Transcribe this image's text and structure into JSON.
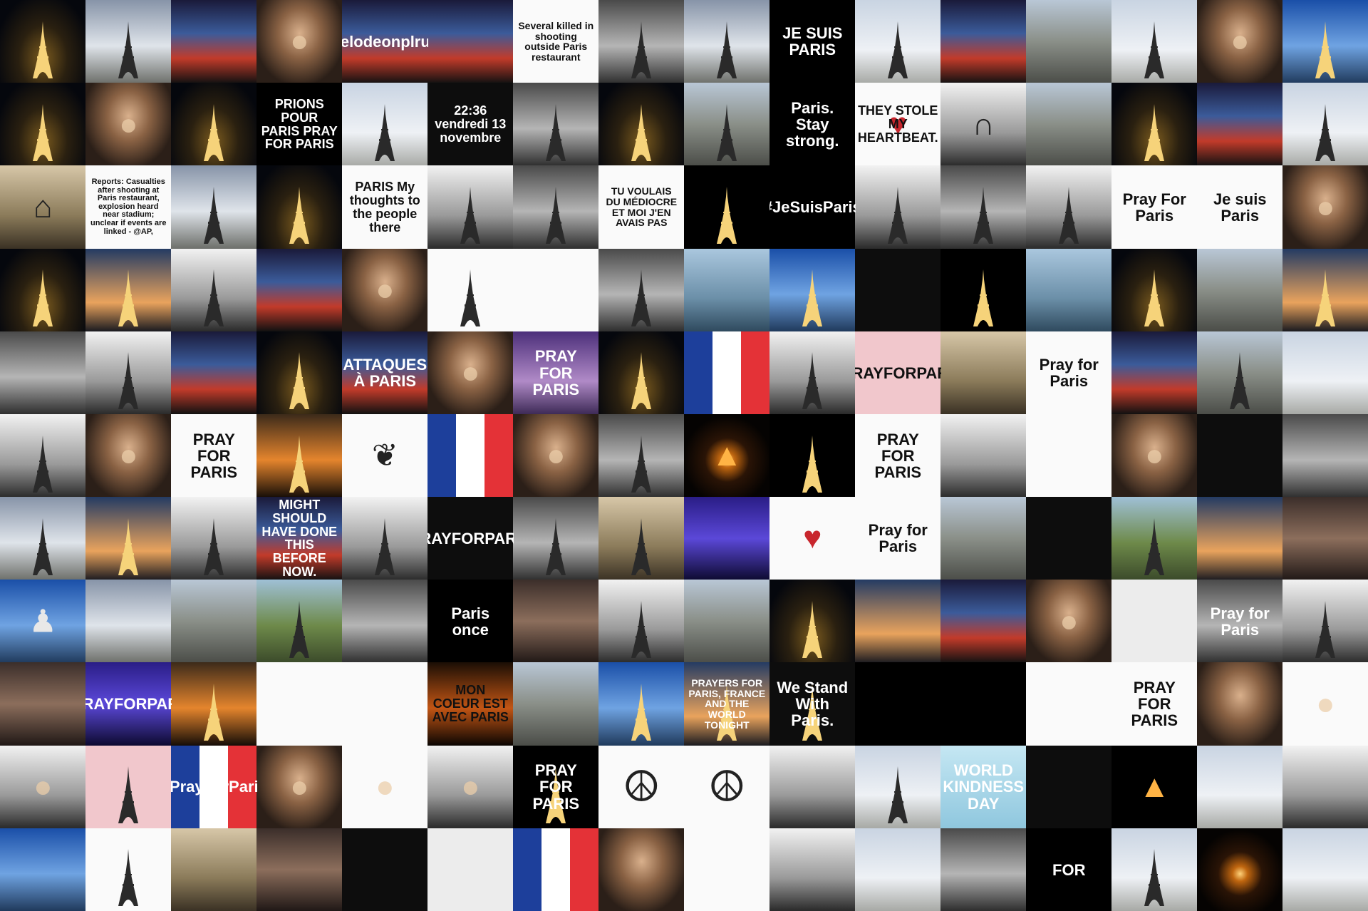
{
  "grid": {
    "columns": 16,
    "rows": 11
  },
  "accent_bar_color": "#2c3f8f",
  "tiles": [
    {
      "style": "bg-night",
      "icon": "eiffel-tower-icon"
    },
    {
      "style": "bg-cloud",
      "icon": "eiffel-tower-icon"
    },
    {
      "style": "bg-news",
      "icon": ""
    },
    {
      "style": "bg-portrait",
      "icon": "person-icon"
    },
    {
      "style": "bg-news",
      "icon": "",
      "text": "nickelodeonplrurner"
    },
    {
      "style": "bg-news",
      "icon": ""
    },
    {
      "style": "bg-white",
      "icon": "",
      "text": "Several killed in shooting outside Paris restaurant",
      "text_style": "t-dark"
    },
    {
      "style": "bg-gray",
      "icon": "eiffel-tower-icon"
    },
    {
      "style": "bg-cloud",
      "icon": "eiffel-tower-icon"
    },
    {
      "style": "bg-black",
      "icon": "",
      "text": "JE SUIS PARIS",
      "text_style": "t-light"
    },
    {
      "style": "bg-sky",
      "icon": "eiffel-tower-icon"
    },
    {
      "style": "bg-news",
      "icon": ""
    },
    {
      "style": "bg-city",
      "icon": ""
    },
    {
      "style": "bg-sky",
      "icon": "eiffel-tower-icon"
    },
    {
      "style": "bg-portrait",
      "icon": "person-icon"
    },
    {
      "style": "bg-blue",
      "icon": "eiffel-tower-icon"
    },
    {
      "style": "bg-night",
      "icon": "eiffel-tower-icon"
    },
    {
      "style": "bg-portrait",
      "icon": "person-icon"
    },
    {
      "style": "bg-night",
      "icon": "eiffel-tower-icon"
    },
    {
      "style": "bg-black",
      "icon": "",
      "text": "PRIONS POUR PARIS PRAY FOR PARIS",
      "text_style": "t-light"
    },
    {
      "style": "bg-sky",
      "icon": "eiffel-tower-icon"
    },
    {
      "style": "bg-dark",
      "icon": "",
      "text": "22:36 vendredi 13 novembre",
      "text_style": "t-light"
    },
    {
      "style": "bg-gray",
      "icon": "eiffel-tower-icon"
    },
    {
      "style": "bg-night",
      "icon": "eiffel-tower-icon"
    },
    {
      "style": "bg-city",
      "icon": "eiffel-tower-icon"
    },
    {
      "style": "bg-black",
      "icon": "",
      "text": "Paris. Stay strong.",
      "text_style": "t-light"
    },
    {
      "style": "bg-white",
      "icon": "heart-icon",
      "text": "THEY STOLE MY HEARTBEAT.",
      "text_style": "t-dark"
    },
    {
      "style": "bg-bw",
      "icon": "arc-de-triomphe-icon"
    },
    {
      "style": "bg-city",
      "icon": ""
    },
    {
      "style": "bg-night",
      "icon": "eiffel-tower-icon"
    },
    {
      "style": "bg-news",
      "icon": ""
    },
    {
      "style": "bg-sky",
      "icon": "eiffel-tower-icon"
    },
    {
      "style": "bg-stone",
      "icon": "notre-dame-icon"
    },
    {
      "style": "bg-white",
      "icon": "",
      "text": "Reports: Casualties after shooting at Paris restaurant, explosion heard near stadium; unclear if events are linked - @AP,",
      "text_style": "t-dark"
    },
    {
      "style": "bg-cloud",
      "icon": "eiffel-tower-icon"
    },
    {
      "style": "bg-night",
      "icon": "eiffel-tower-icon"
    },
    {
      "style": "bg-white",
      "icon": "",
      "text": "PARIS My thoughts to the people there",
      "text_style": "t-dark"
    },
    {
      "style": "bg-bw",
      "icon": "eiffel-tower-icon"
    },
    {
      "style": "bg-gray",
      "icon": "eiffel-tower-icon"
    },
    {
      "style": "bg-white",
      "icon": "",
      "text": "TU VOULAIS DU MÉDIOCRE ET MOI J'EN AVAIS PAS",
      "text_style": "t-dark"
    },
    {
      "style": "bg-black",
      "icon": "eiffel-tower-icon"
    },
    {
      "style": "bg-black",
      "icon": "",
      "text": "#JeSuisParis",
      "text_style": "t-light"
    },
    {
      "style": "bg-bw",
      "icon": "eiffel-tower-icon"
    },
    {
      "style": "bg-gray",
      "icon": "eiffel-tower-icon"
    },
    {
      "style": "bg-bw",
      "icon": "eiffel-tower-icon"
    },
    {
      "style": "bg-white",
      "icon": "",
      "text": "Pray For Paris",
      "text_style": "t-dark"
    },
    {
      "style": "bg-white",
      "icon": "",
      "text": "Je suis Paris",
      "text_style": "t-dark"
    },
    {
      "style": "bg-portrait",
      "icon": "person-icon"
    },
    {
      "style": "bg-night",
      "icon": "eiffel-tower-icon"
    },
    {
      "style": "bg-dusk",
      "icon": "eiffel-tower-icon"
    },
    {
      "style": "bg-bw",
      "icon": "eiffel-tower-icon"
    },
    {
      "style": "bg-news",
      "icon": ""
    },
    {
      "style": "bg-portrait",
      "icon": "person-icon"
    },
    {
      "style": "bg-white",
      "icon": "eiffel-tower-icon"
    },
    {
      "style": "bg-white",
      "icon": "",
      "text": "",
      "text_style": "t-dark"
    },
    {
      "style": "bg-gray",
      "icon": "eiffel-tower-icon"
    },
    {
      "style": "bg-river",
      "icon": ""
    },
    {
      "style": "bg-blue",
      "icon": "eiffel-tower-icon"
    },
    {
      "style": "bg-dark",
      "icon": ""
    },
    {
      "style": "bg-black",
      "icon": "eiffel-tower-icon"
    },
    {
      "style": "bg-river",
      "icon": ""
    },
    {
      "style": "bg-night",
      "icon": "eiffel-tower-icon"
    },
    {
      "style": "bg-city",
      "icon": ""
    },
    {
      "style": "bg-dusk",
      "icon": "eiffel-tower-icon"
    },
    {
      "style": "bg-gray",
      "icon": ""
    },
    {
      "style": "bg-bw",
      "icon": "eiffel-tower-icon"
    },
    {
      "style": "bg-news",
      "icon": ""
    },
    {
      "style": "bg-night",
      "icon": "eiffel-tower-icon"
    },
    {
      "style": "bg-news",
      "icon": "",
      "text": "ATTAQUES À PARIS",
      "text_style": "t-light"
    },
    {
      "style": "bg-portrait",
      "icon": "person-icon"
    },
    {
      "style": "bg-purple",
      "icon": "",
      "text": "PRAY FOR PARIS",
      "text_style": "t-light"
    },
    {
      "style": "bg-night",
      "icon": "eiffel-tower-icon"
    },
    {
      "style": "bg-flag",
      "icon": "flag-icon"
    },
    {
      "style": "bg-bw",
      "icon": "eiffel-tower-icon"
    },
    {
      "style": "bg-pink",
      "icon": "",
      "text": "#PRAYFORPARIS",
      "text_style": "t-dark"
    },
    {
      "style": "bg-stone",
      "icon": ""
    },
    {
      "style": "bg-white",
      "icon": "",
      "text": "Pray for Paris",
      "text_style": "t-dark"
    },
    {
      "style": "bg-news",
      "icon": ""
    },
    {
      "style": "bg-city",
      "icon": "eiffel-tower-icon"
    },
    {
      "style": "bg-sky",
      "icon": ""
    },
    {
      "style": "bg-bw",
      "icon": "eiffel-tower-icon"
    },
    {
      "style": "bg-portrait",
      "icon": "person-icon"
    },
    {
      "style": "bg-white",
      "icon": "",
      "text": "PRAY FOR PARIS",
      "text_style": "t-dark"
    },
    {
      "style": "bg-sunset",
      "icon": "eiffel-tower-icon"
    },
    {
      "style": "bg-white",
      "icon": "ribbon-icon"
    },
    {
      "style": "bg-flag",
      "icon": ""
    },
    {
      "style": "bg-portrait",
      "icon": "person-icon"
    },
    {
      "style": "bg-gray",
      "icon": "eiffel-tower-icon"
    },
    {
      "style": "bg-candle",
      "icon": "candle-icon"
    },
    {
      "style": "bg-black",
      "icon": "eiffel-tower-icon"
    },
    {
      "style": "bg-white",
      "icon": "",
      "text": "PRAY FOR PARIS",
      "text_style": "t-dark"
    },
    {
      "style": "bg-bw",
      "icon": ""
    },
    {
      "style": "bg-white",
      "icon": "",
      "text": "",
      "text_style": "t-dark"
    },
    {
      "style": "bg-portrait",
      "icon": "dog-icon"
    },
    {
      "style": "bg-dark",
      "icon": ""
    },
    {
      "style": "bg-gray",
      "icon": ""
    },
    {
      "style": "bg-cloud",
      "icon": "eiffel-tower-icon"
    },
    {
      "style": "bg-dusk",
      "icon": "eiffel-tower-icon"
    },
    {
      "style": "bg-bw",
      "icon": "eiffel-tower-icon"
    },
    {
      "style": "bg-news",
      "icon": "",
      "text": "MIGHT SHOULD HAVE DONE THIS BEFORE NOW.",
      "text_style": "t-light"
    },
    {
      "style": "bg-bw",
      "icon": "eiffel-tower-icon"
    },
    {
      "style": "bg-dark",
      "icon": "",
      "text": "PRAYFORPARIS",
      "text_style": "t-light"
    },
    {
      "style": "bg-gray",
      "icon": "eiffel-tower-icon"
    },
    {
      "style": "bg-stone",
      "icon": "eiffel-tower-icon"
    },
    {
      "style": "bg-blueviolet",
      "icon": ""
    },
    {
      "style": "bg-white",
      "icon": "heart-icon"
    },
    {
      "style": "bg-white",
      "icon": "",
      "text": "Pray for Paris",
      "text_style": "t-dark"
    },
    {
      "style": "bg-city",
      "icon": ""
    },
    {
      "style": "bg-dark",
      "icon": ""
    },
    {
      "style": "bg-green",
      "icon": "eiffel-tower-icon"
    },
    {
      "style": "bg-dusk",
      "icon": ""
    },
    {
      "style": "bg-crowd",
      "icon": ""
    },
    {
      "style": "bg-blue",
      "icon": "statue-icon"
    },
    {
      "style": "bg-cloud",
      "icon": ""
    },
    {
      "style": "bg-city",
      "icon": ""
    },
    {
      "style": "bg-green",
      "icon": "eiffel-tower-icon"
    },
    {
      "style": "bg-gray",
      "icon": ""
    },
    {
      "style": "bg-black",
      "icon": "",
      "text": "Paris once",
      "text_style": "t-light"
    },
    {
      "style": "bg-crowd",
      "icon": ""
    },
    {
      "style": "bg-bw",
      "icon": "eiffel-tower-icon"
    },
    {
      "style": "bg-city",
      "icon": ""
    },
    {
      "style": "bg-night",
      "icon": "eiffel-tower-icon"
    },
    {
      "style": "bg-dusk",
      "icon": ""
    },
    {
      "style": "bg-news",
      "icon": ""
    },
    {
      "style": "bg-portrait",
      "icon": "person-icon"
    },
    {
      "style": "bg-lightgray",
      "icon": ""
    },
    {
      "style": "bg-gray",
      "icon": "",
      "text": "Pray for Paris",
      "text_style": "t-light"
    },
    {
      "style": "bg-bw",
      "icon": "eiffel-tower-icon"
    },
    {
      "style": "bg-crowd",
      "icon": ""
    },
    {
      "style": "bg-blueviolet",
      "icon": "",
      "text": "#PRAYFORPARIS",
      "text_style": "t-light"
    },
    {
      "style": "bg-sunset",
      "icon": "eiffel-tower-icon"
    },
    {
      "style": "bg-white",
      "icon": "",
      "text": "",
      "text_style": "t-dark"
    },
    {
      "style": "bg-white",
      "icon": "",
      "text": "",
      "text_style": "t-dark"
    },
    {
      "style": "bg-orange",
      "icon": "",
      "text": "MON COEUR EST AVEC PARIS",
      "text_style": "t-dark"
    },
    {
      "style": "bg-city",
      "icon": ""
    },
    {
      "style": "bg-blue",
      "icon": "eiffel-tower-icon"
    },
    {
      "style": "bg-dusk",
      "icon": "eiffel-tower-icon",
      "text": "PRAYERS FOR PARIS, FRANCE AND THE WORLD TONIGHT",
      "text_style": "t-light"
    },
    {
      "style": "bg-dark",
      "icon": "eiffel-tower-icon",
      "text": "We Stand With Paris.",
      "text_style": "t-light"
    },
    {
      "style": "bg-black",
      "icon": ""
    },
    {
      "style": "bg-black",
      "icon": ""
    },
    {
      "style": "bg-white",
      "icon": "",
      "text": "",
      "text_style": "t-dark"
    },
    {
      "style": "bg-white",
      "icon": "",
      "text": "PRAY FOR PARIS",
      "text_style": "t-dark"
    },
    {
      "style": "bg-portrait",
      "icon": ""
    },
    {
      "style": "bg-white",
      "icon": "person-icon"
    },
    {
      "style": "bg-bw",
      "icon": "person-icon"
    },
    {
      "style": "bg-pink",
      "icon": "eiffel-tower-icon"
    },
    {
      "style": "bg-flag",
      "icon": "",
      "text": "#PrayForParis",
      "text_style": "t-light"
    },
    {
      "style": "bg-portrait",
      "icon": "person-icon"
    },
    {
      "style": "bg-white",
      "icon": "person-icon"
    },
    {
      "style": "bg-bw",
      "icon": "person-icon"
    },
    {
      "style": "bg-black",
      "icon": "eiffel-tower-icon",
      "text": "PRAY FOR PARIS",
      "text_style": "t-light"
    },
    {
      "style": "bg-white",
      "icon": "peace-icon"
    },
    {
      "style": "bg-white",
      "icon": "peace-icon"
    },
    {
      "style": "bg-bw",
      "icon": ""
    },
    {
      "style": "bg-sky",
      "icon": "eiffel-tower-icon"
    },
    {
      "style": "bg-lightblue",
      "icon": "",
      "text": "WORLD KINDNESS DAY",
      "text_style": "t-light"
    },
    {
      "style": "bg-dark",
      "icon": ""
    },
    {
      "style": "bg-black",
      "icon": "candle-icon"
    },
    {
      "style": "bg-sky",
      "icon": ""
    },
    {
      "style": "bg-bw",
      "icon": ""
    },
    {
      "style": "bg-blue",
      "icon": ""
    },
    {
      "style": "bg-white",
      "icon": "eiffel-tower-icon"
    },
    {
      "style": "bg-stone",
      "icon": ""
    },
    {
      "style": "bg-crowd",
      "icon": ""
    },
    {
      "style": "bg-dark",
      "icon": ""
    },
    {
      "style": "bg-lightgray",
      "icon": ""
    },
    {
      "style": "bg-flag",
      "icon": ""
    },
    {
      "style": "bg-portrait",
      "icon": ""
    },
    {
      "style": "bg-white",
      "icon": ""
    },
    {
      "style": "bg-bw",
      "icon": ""
    },
    {
      "style": "bg-sky",
      "icon": ""
    },
    {
      "style": "bg-gray",
      "icon": ""
    },
    {
      "style": "bg-black",
      "icon": "",
      "text": "FOR",
      "text_style": "t-light"
    },
    {
      "style": "bg-sky",
      "icon": "eiffel-tower-icon"
    },
    {
      "style": "bg-candle",
      "icon": ""
    },
    {
      "style": "bg-sky",
      "icon": ""
    }
  ]
}
